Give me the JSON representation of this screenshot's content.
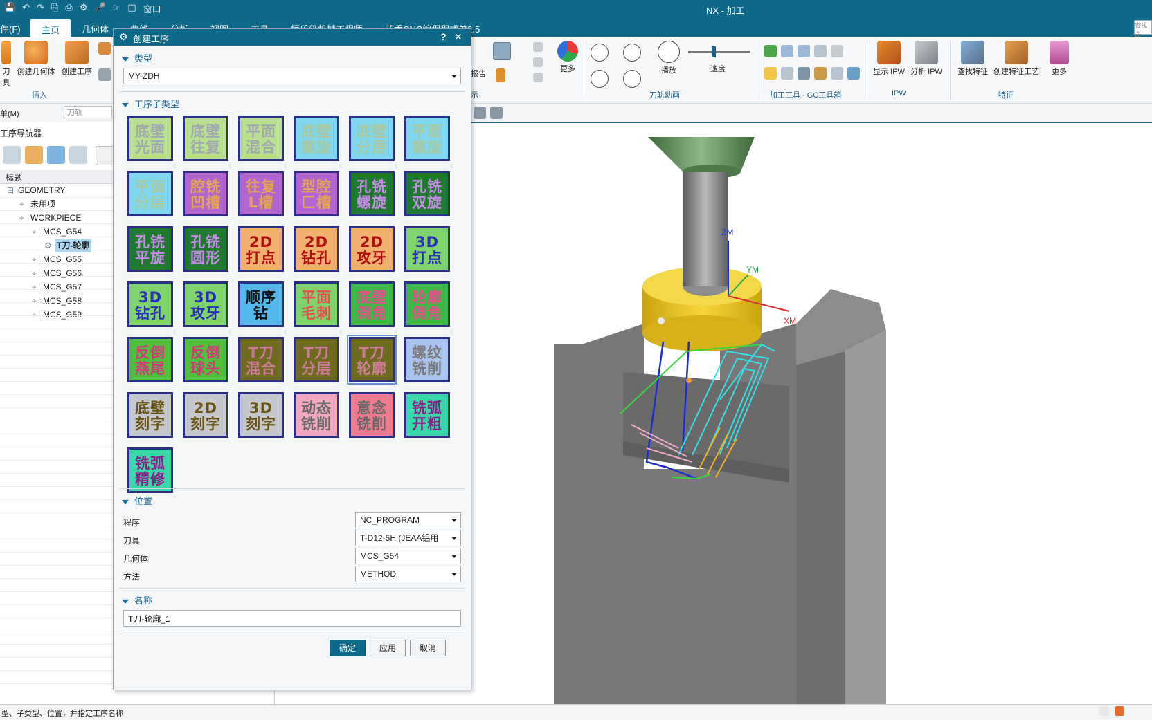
{
  "window": {
    "title": "NX - 加工",
    "window_menu": "窗口"
  },
  "menubar": {
    "items": [
      "件(F)",
      "主页",
      "几何体",
      "曲线",
      "分析",
      "视图",
      "工具",
      "恒乐级机械工程师",
      "艺香CNC编程程式单2.5"
    ],
    "search_placeholder": "查找命"
  },
  "ribbon": {
    "left_buttons": [
      "刀具",
      "创建几何体",
      "创建工序"
    ],
    "insert_group": "插入",
    "display_group_fragment": "示",
    "report_label": "报告",
    "more_label": "更多",
    "playback_label": "播放",
    "speed_label": "速度",
    "toolpath_anim_group": "刀轨动画",
    "machining_tools_group": "加工工具 - GC工具箱",
    "show_ipw": "显示 IPW",
    "analyze_ipw": "分析 IPW",
    "ipw_group": "IPW",
    "find_feature": "查找特征",
    "create_feature_process": "创建特征工艺",
    "more_label2": "更多",
    "feature_group": "特征"
  },
  "subbar": {
    "menu_label": "单(M)",
    "filter_placeholder": "刀轨"
  },
  "navigator": {
    "title": "工序导航器",
    "column_header": "标题",
    "tree": [
      {
        "label": "GEOMETRY",
        "indent": 0
      },
      {
        "label": "未用项",
        "indent": 1
      },
      {
        "label": "WORKPIECE",
        "indent": 1
      },
      {
        "label": "MCS_G54",
        "indent": 2
      },
      {
        "label": "T刀-轮廓",
        "indent": 3,
        "selected": true
      },
      {
        "label": "MCS_G55",
        "indent": 2
      },
      {
        "label": "MCS_G56",
        "indent": 2
      },
      {
        "label": "MCS_G57",
        "indent": 2
      },
      {
        "label": "MCS_G58",
        "indent": 2
      },
      {
        "label": "MCS_G59",
        "indent": 2
      }
    ]
  },
  "dialog": {
    "title": "创建工序",
    "help": "?",
    "close": "✕",
    "type_section": "类型",
    "type_value": "MY-ZDH",
    "subtype_section": "工序子类型",
    "tiles": [
      {
        "l1": "底壁",
        "l2": "光面",
        "bg": "#b8e08e",
        "fg": "#a0a8b0"
      },
      {
        "l1": "底壁",
        "l2": "往复",
        "bg": "#b8e08e",
        "fg": "#a0a8b0"
      },
      {
        "l1": "平面",
        "l2": "混合",
        "bg": "#b8e08e",
        "fg": "#a0a8b0"
      },
      {
        "l1": "底壁",
        "l2": "螺旋",
        "bg": "#7fd7ef",
        "fg": "#a8c8a0"
      },
      {
        "l1": "底壁",
        "l2": "分层",
        "bg": "#7fd7ef",
        "fg": "#a8c8a0"
      },
      {
        "l1": "平面",
        "l2": "螺旋",
        "bg": "#7fd7ef",
        "fg": "#a8c8a0"
      },
      {
        "l1": "平面",
        "l2": "分层",
        "bg": "#7fd7ef",
        "fg": "#a8c8a0"
      },
      {
        "l1": "腔铣",
        "l2": "凹槽",
        "bg": "#b066cc",
        "fg": "#e4a35a"
      },
      {
        "l1": "往复",
        "l2": "L槽",
        "bg": "#b066cc",
        "fg": "#e4a35a"
      },
      {
        "l1": "型腔",
        "l2": "匚槽",
        "bg": "#b066cc",
        "fg": "#e4a35a"
      },
      {
        "l1": "孔铣",
        "l2": "螺旋",
        "bg": "#1f7a2e",
        "fg": "#c58be6"
      },
      {
        "l1": "孔铣",
        "l2": "双旋",
        "bg": "#1f7a2e",
        "fg": "#c58be6"
      },
      {
        "l1": "孔铣",
        "l2": "平旋",
        "bg": "#1f7a2e",
        "fg": "#c58be6"
      },
      {
        "l1": "孔铣",
        "l2": "圆形",
        "bg": "#1f7a2e",
        "fg": "#c58be6"
      },
      {
        "l1": "2D",
        "l2": "打点",
        "bg": "#f2b070",
        "fg": "#b01010"
      },
      {
        "l1": "2D",
        "l2": "钻孔",
        "bg": "#f2b070",
        "fg": "#b01010"
      },
      {
        "l1": "2D",
        "l2": "攻牙",
        "bg": "#f2b070",
        "fg": "#b01010"
      },
      {
        "l1": "3D",
        "l2": "打点",
        "bg": "#7ed36a",
        "fg": "#2b2fb8"
      },
      {
        "l1": "3D",
        "l2": "钻孔",
        "bg": "#7ed36a",
        "fg": "#2b2fb8"
      },
      {
        "l1": "3D",
        "l2": "攻牙",
        "bg": "#7ed36a",
        "fg": "#2b2fb8"
      },
      {
        "l1": "顺序",
        "l2": "钻",
        "bg": "#55b8ea",
        "fg": "#111111"
      },
      {
        "l1": "平面",
        "l2": "毛刺",
        "bg": "#7ed36a",
        "fg": "#e05050"
      },
      {
        "l1": "底壁",
        "l2": "倒角",
        "bg": "#3fb84a",
        "fg": "#e0508a"
      },
      {
        "l1": "轮廓",
        "l2": "倒角",
        "bg": "#3fb84a",
        "fg": "#e0508a"
      },
      {
        "l1": "反倒",
        "l2": "燕尾",
        "bg": "#52bf3c",
        "fg": "#d03a7a"
      },
      {
        "l1": "反倒",
        "l2": "球头",
        "bg": "#52bf3c",
        "fg": "#d03a7a"
      },
      {
        "l1": "T刀",
        "l2": "混合",
        "bg": "#6e6a1f",
        "fg": "#d07a9a"
      },
      {
        "l1": "T刀",
        "l2": "分层",
        "bg": "#6e6a1f",
        "fg": "#d07a9a"
      },
      {
        "l1": "T刀",
        "l2": "轮廓",
        "bg": "#6e6a1f",
        "fg": "#d07a9a",
        "selected": true
      },
      {
        "l1": "螺纹",
        "l2": "铣削",
        "bg": "#a9c4ee",
        "fg": "#7a7a7a"
      },
      {
        "l1": "底壁",
        "l2": "刻字",
        "bg": "#c4c7cc",
        "fg": "#6a5418"
      },
      {
        "l1": "2D",
        "l2": "刻字",
        "bg": "#c4c7cc",
        "fg": "#6a5418"
      },
      {
        "l1": "3D",
        "l2": "刻字",
        "bg": "#c4c7cc",
        "fg": "#6a5418"
      },
      {
        "l1": "动态",
        "l2": "铣削",
        "bg": "#f4a7c0",
        "fg": "#6a6a6a"
      },
      {
        "l1": "意念",
        "l2": "铣削",
        "bg": "#f07a8e",
        "fg": "#6a6a6a"
      },
      {
        "l1": "铣弧",
        "l2": "开粗",
        "bg": "#39d8a8",
        "fg": "#8a1f8a"
      },
      {
        "l1": "铣弧",
        "l2": "精修",
        "bg": "#39d8a8",
        "fg": "#8a1f8a"
      }
    ],
    "location_section": "位置",
    "fields": [
      {
        "label": "程序",
        "value": "NC_PROGRAM"
      },
      {
        "label": "刀具",
        "value": "T-D12-5H (JEAA铝用"
      },
      {
        "label": "几何体",
        "value": "MCS_G54"
      },
      {
        "label": "方法",
        "value": "METHOD"
      }
    ],
    "name_section": "名称",
    "name_value": "T刀-轮廓_1",
    "ok": "确定",
    "apply": "应用",
    "cancel": "取消"
  },
  "viewport": {
    "axis_z": "ZM",
    "axis_y": "YM",
    "axis_x": "XM"
  },
  "statusbar": {
    "text": "型、子类型、位置，并指定工序名称"
  },
  "colors": {
    "accent": "#0f6a8a",
    "tile_border": "#2a2f8a",
    "toolpath_cyan": "#34e0e8",
    "tool_holder": "#f0c71c"
  }
}
